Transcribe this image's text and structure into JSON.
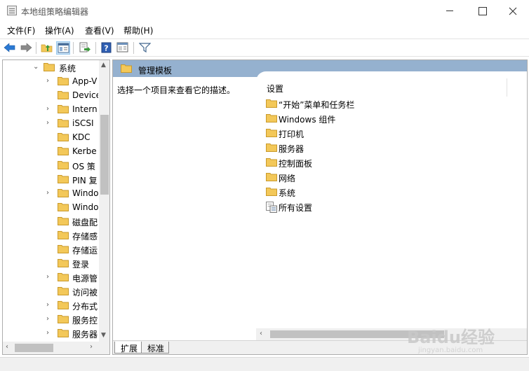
{
  "window": {
    "title": "本地组策略编辑器"
  },
  "menu": [
    "文件(F)",
    "操作(A)",
    "查看(V)",
    "帮助(H)"
  ],
  "toolbar": {
    "buttons": [
      "back-icon",
      "forward-icon",
      "up-folder-icon",
      "show-hide-tree-icon",
      "export-list-icon",
      "help-icon",
      "properties-icon",
      "filter-icon"
    ],
    "active": "show-hide-tree-icon"
  },
  "tree": {
    "items": [
      {
        "label": "系统",
        "expanded": true
      },
      {
        "label": "App-V",
        "expandable": true
      },
      {
        "label": "Device",
        "expandable": false
      },
      {
        "label": "Intern",
        "expandable": true
      },
      {
        "label": "iSCSI",
        "expandable": true
      },
      {
        "label": "KDC",
        "expandable": false
      },
      {
        "label": "Kerbe",
        "expandable": false
      },
      {
        "label": "OS 策",
        "expandable": false
      },
      {
        "label": "PIN 复",
        "expandable": false
      },
      {
        "label": "Windo",
        "expandable": true
      },
      {
        "label": "Windo",
        "expandable": false
      },
      {
        "label": "磁盘配",
        "expandable": false
      },
      {
        "label": "存储感",
        "expandable": false
      },
      {
        "label": "存储运",
        "expandable": false
      },
      {
        "label": "登录",
        "expandable": false
      },
      {
        "label": "电源管",
        "expandable": true
      },
      {
        "label": "访问被",
        "expandable": false
      },
      {
        "label": "分布式",
        "expandable": true
      },
      {
        "label": "服务控",
        "expandable": true
      },
      {
        "label": "服务器",
        "expandable": true
      }
    ]
  },
  "details": {
    "header_title": "管理模板",
    "description": "选择一个项目来查看它的描述。",
    "column_header": "设置",
    "items": [
      {
        "label": "“开始”菜单和任务栏",
        "icon": "folder-icon"
      },
      {
        "label": "Windows 组件",
        "icon": "folder-icon"
      },
      {
        "label": "打印机",
        "icon": "folder-icon"
      },
      {
        "label": "服务器",
        "icon": "folder-icon"
      },
      {
        "label": "控制面板",
        "icon": "folder-icon"
      },
      {
        "label": "网络",
        "icon": "folder-icon"
      },
      {
        "label": "系统",
        "icon": "folder-icon"
      },
      {
        "label": "所有设置",
        "icon": "all-settings-icon"
      }
    ]
  },
  "tabs": [
    "扩展",
    "标准"
  ],
  "watermark": {
    "main": "Baidu经验",
    "sub": "jingyan.baidu.com"
  },
  "colors": {
    "header_band": "#95b1cf",
    "folder": "#f3c859",
    "selection": "#cce4f7"
  }
}
